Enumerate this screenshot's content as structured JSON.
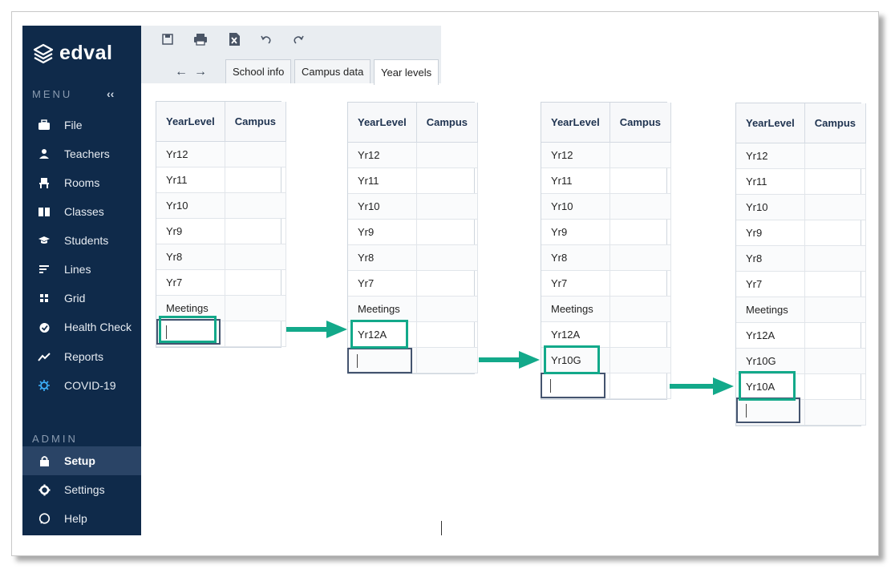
{
  "app": {
    "logo_text": "edval"
  },
  "sidebar": {
    "menu_heading": "MENU",
    "collapse_label": "‹‹",
    "items": [
      {
        "label": "File",
        "icon": "briefcase-icon"
      },
      {
        "label": "Teachers",
        "icon": "person-icon"
      },
      {
        "label": "Rooms",
        "icon": "chair-icon"
      },
      {
        "label": "Classes",
        "icon": "book-icon"
      },
      {
        "label": "Students",
        "icon": "graduation-cap-icon"
      },
      {
        "label": "Lines",
        "icon": "lines-icon"
      },
      {
        "label": "Grid",
        "icon": "grid-icon"
      },
      {
        "label": "Health Check",
        "icon": "check-badge-icon"
      },
      {
        "label": "Reports",
        "icon": "trend-icon"
      },
      {
        "label": "COVID-19",
        "icon": "virus-icon"
      }
    ],
    "admin_heading": "ADMIN",
    "admin_items": [
      {
        "label": "Setup",
        "icon": "lock-icon",
        "active": true
      },
      {
        "label": "Settings",
        "icon": "gear-icon"
      },
      {
        "label": "Help",
        "icon": "help-icon"
      }
    ]
  },
  "toolbar": {
    "icons": [
      "save-icon",
      "print-icon",
      "excel-icon",
      "undo-icon",
      "redo-icon"
    ],
    "back": "←",
    "forward": "→",
    "tabs": [
      "School info",
      "Campus data",
      "Year levels"
    ],
    "active_tab": "Year levels"
  },
  "grids": [
    {
      "headers": [
        "YearLevel",
        "Campus"
      ],
      "rows": [
        "Yr12",
        "Yr11",
        "Yr10",
        "Yr9",
        "Yr8",
        "Yr7",
        "Meetings"
      ]
    },
    {
      "headers": [
        "YearLevel",
        "Campus"
      ],
      "rows": [
        "Yr12",
        "Yr11",
        "Yr10",
        "Yr9",
        "Yr8",
        "Yr7",
        "Meetings",
        "Yr12A"
      ]
    },
    {
      "headers": [
        "YearLevel",
        "Campus"
      ],
      "rows": [
        "Yr12",
        "Yr11",
        "Yr10",
        "Yr9",
        "Yr8",
        "Yr7",
        "Meetings",
        "Yr12A",
        "Yr10G"
      ]
    },
    {
      "headers": [
        "YearLevel",
        "Campus"
      ],
      "rows": [
        "Yr12",
        "Yr11",
        "Yr10",
        "Yr9",
        "Yr8",
        "Yr7",
        "Meetings",
        "Yr12A",
        "Yr10G",
        "Yr10A"
      ]
    }
  ],
  "colors": {
    "sidebar_bg": "#0f2a4a",
    "highlight": "#13a98a",
    "edit_border": "#44546f"
  }
}
